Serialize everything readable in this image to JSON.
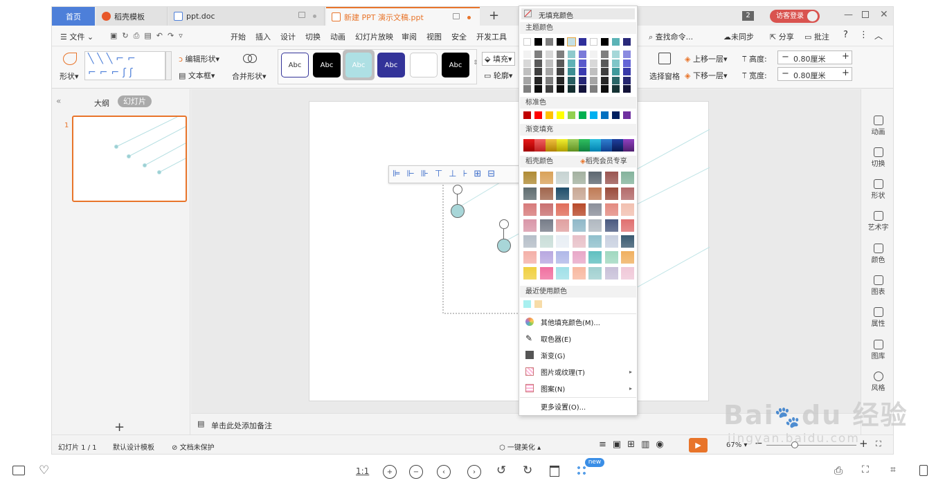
{
  "tabs": [
    {
      "label": "首页"
    },
    {
      "label": "稻壳模板"
    },
    {
      "label": "ppt.doc"
    },
    {
      "label": "新建 PPT 演示文稿.ppt"
    }
  ],
  "titlebar": {
    "count_badge": "2",
    "login_button": "访客登录"
  },
  "menu": {
    "file": "文件",
    "items": [
      "开始",
      "插入",
      "设计",
      "切换",
      "动画",
      "幻灯片放映",
      "审阅",
      "视图",
      "安全",
      "开发工具"
    ],
    "search": "查找命令...",
    "sync": "未同步",
    "share": "分享",
    "comment": "批注"
  },
  "ribbon": {
    "shape": "形状",
    "edit_shape": "编辑形状",
    "textbox": "文本框",
    "merge_shape": "合并形状",
    "style_label": "Abc",
    "fill": "填充",
    "outline": "轮廓",
    "selection_pane": "选择窗格",
    "bring_forward": "上移一层",
    "send_backward": "下移一层",
    "height_label": "高度:",
    "height_value": "0.80厘米",
    "width_label": "宽度:",
    "width_value": "0.80厘米"
  },
  "leftpanel": {
    "outline_tab": "大纲",
    "slides_tab": "幻灯片",
    "slide_number": "1",
    "add_symbol": "+"
  },
  "notes": {
    "placeholder": "单击此处添加备注"
  },
  "rightbar": [
    "动画",
    "切换",
    "形状",
    "艺术字",
    "颜色",
    "图表",
    "属性",
    "图库",
    "风格"
  ],
  "status": {
    "slide_info": "幻灯片 1 / 1",
    "template": "默认设计模板",
    "protect": "文档未保护",
    "beautify": "一键美化",
    "zoom": "67%"
  },
  "dropdown": {
    "no_fill": "无填充颜色",
    "theme_colors": "主题颜色",
    "standard_colors": "标准色",
    "gradient_fill": "渐变填充",
    "docer_colors": "稻壳颜色",
    "docer_member": "稻壳会员专享",
    "recent_colors": "最近使用颜色",
    "more_fill": "其他填充颜色(M)...",
    "eyedropper": "取色器(E)",
    "gradient": "渐变(G)",
    "picture_texture": "图片或纹理(T)",
    "pattern": "图案(N)",
    "more_settings": "更多设置(O)...",
    "theme_top": [
      "#ffffff",
      "#000000",
      "#7f7f7f",
      "#000000",
      "#c5e0e4",
      "#2f2f9a",
      "#ffffff",
      "#000000",
      "#5bb3b6",
      "#2a2a7a"
    ],
    "theme_shades": [
      [
        "#f2f2f2",
        "#7f7f7f",
        "#d8d8d8",
        "#7f7f7f",
        "#8ec9cc",
        "#7a7ad9",
        "#f2f2f2",
        "#7f7f7f",
        "#a5d7d8",
        "#8a8ae0"
      ],
      [
        "#d8d8d8",
        "#595959",
        "#bfbfbf",
        "#595959",
        "#5fb1b6",
        "#5a5acc",
        "#d8d8d8",
        "#595959",
        "#7fc6c8",
        "#6565d6"
      ],
      [
        "#bfbfbf",
        "#3f3f3f",
        "#a5a5a5",
        "#3f3f3f",
        "#3c8d92",
        "#3a3ab0",
        "#bfbfbf",
        "#3f3f3f",
        "#3f9a9c",
        "#3838a8"
      ],
      [
        "#a5a5a5",
        "#262626",
        "#7f7f7f",
        "#262626",
        "#285e61",
        "#262676",
        "#a5a5a5",
        "#262626",
        "#2a6768",
        "#262670"
      ],
      [
        "#7f7f7f",
        "#0c0c0c",
        "#3f3f3f",
        "#0c0c0c",
        "#142f30",
        "#13133b",
        "#7f7f7f",
        "#0c0c0c",
        "#153334",
        "#131338"
      ]
    ],
    "standard": [
      "#c00000",
      "#ff0000",
      "#ffc000",
      "#ffff00",
      "#92d050",
      "#00b050",
      "#00b0f0",
      "#0070c0",
      "#002060",
      "#7030a0"
    ],
    "gradients": [
      [
        "#e81a1a",
        "#a00000"
      ],
      [
        "#f06060",
        "#c02020"
      ],
      [
        "#f0c040",
        "#b08000"
      ],
      [
        "#f0f030",
        "#b0a000"
      ],
      [
        "#a0d060",
        "#609020"
      ],
      [
        "#30c060",
        "#108040"
      ],
      [
        "#30c0e0",
        "#0080b0"
      ],
      [
        "#3080d0",
        "#104090"
      ],
      [
        "#2040a0",
        "#081850"
      ],
      [
        "#9040c0",
        "#502070"
      ]
    ],
    "docer": [
      [
        "#b08b35",
        "#d9a25a",
        "#c6d3d2",
        "#a3b1a0",
        "#5d6770",
        "#9a5550",
        "#84b39c"
      ],
      [
        "#5f6c70",
        "#a0654c",
        "#1f4d6a",
        "#c8a794",
        "#bf7a55",
        "#9a4b3a",
        "#b36a6a"
      ],
      [
        "#d77a7a",
        "#c97070",
        "#e06d5a",
        "#b84a2a",
        "#8b8f9a",
        "#e38a80",
        "#f2c0b0"
      ],
      [
        "#d996a8",
        "#767c88",
        "#e0a0a0",
        "#8fb8c8",
        "#b0b8c0",
        "#4a5a80",
        "#e07070"
      ],
      [
        "#b5bec8",
        "#c8ddd8",
        "#e8eef4",
        "#e8c0c8",
        "#90c0cc",
        "#c8d0e0",
        "#3a5a70"
      ],
      [
        "#f4b0a8",
        "#b8a8e0",
        "#b0b8e8",
        "#e8a8c8",
        "#60c0c0",
        "#a0d8c0",
        "#f0b060"
      ],
      [
        "#f0d040",
        "#f070a0",
        "#a0e0e8",
        "#f8b8a0",
        "#a0d0d0",
        "#c8c0d8",
        "#f0c8d8"
      ]
    ],
    "recent": [
      "#a8f0f0",
      "#f7dca8"
    ]
  }
}
